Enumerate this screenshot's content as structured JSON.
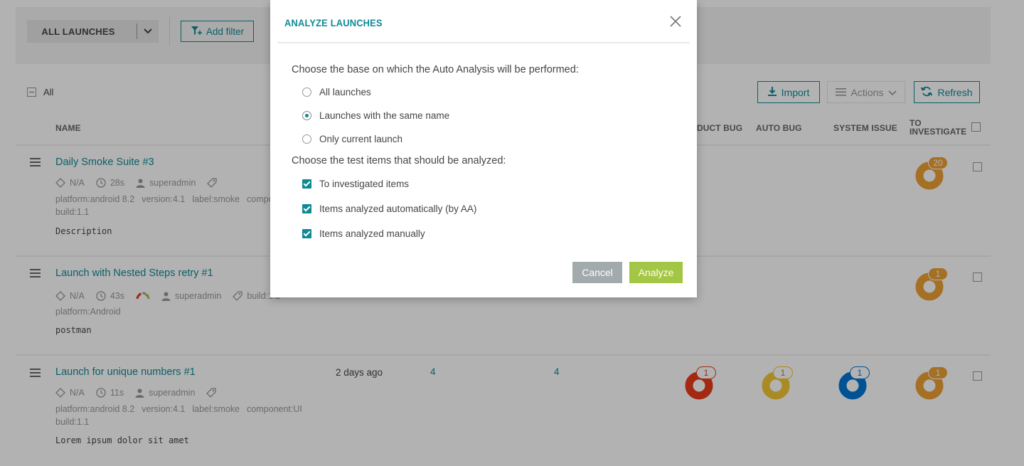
{
  "filter_bar": {
    "launch_selector": "ALL LAUNCHES",
    "add_filter": "Add filter"
  },
  "toolbar": {
    "select_all": "All",
    "import": "Import",
    "actions": "Actions",
    "refresh": "Refresh"
  },
  "columns": {
    "name": "NAME",
    "product_bug": "DUCT BUG",
    "auto_bug": "AUTO BUG",
    "system_issue": "SYSTEM ISSUE",
    "to_investigate_line1": "TO",
    "to_investigate_line2": "INVESTIGATE"
  },
  "launches": [
    {
      "name": "Daily Smoke Suite #3",
      "status": "N/A",
      "duration": "28s",
      "owner": "superadmin",
      "attributes": [
        "platform:android 8.2",
        "version:4.1",
        "label:smoke",
        "compon"
      ],
      "attributes_line2": "build:1.1",
      "description": "Description",
      "to_investigate": "20"
    },
    {
      "name": "Launch with Nested Steps retry #1",
      "status": "N/A",
      "duration": "43s",
      "owner": "superadmin",
      "tag_text": "build:1.2",
      "attributes": [
        "platform:Android"
      ],
      "description": "postman",
      "to_investigate": "1"
    },
    {
      "name": "Launch for unique numbers #1",
      "status": "N/A",
      "duration": "11s",
      "owner": "superadmin",
      "attributes": [
        "platform:android 8.2",
        "version:4.1",
        "label:smoke",
        "component:UI"
      ],
      "attributes_line2": "build:1.1",
      "description": "Lorem ipsum dolor sit amet",
      "start_time": "2 days ago",
      "total": "4",
      "passed": "4",
      "product_bug": "1",
      "auto_bug": "1",
      "system_issue": "1",
      "to_investigate": "1"
    }
  ],
  "modal": {
    "title": "ANALYZE LAUNCHES",
    "base_question": "Choose the base on which the Auto Analysis will be performed:",
    "base_options": [
      "All launches",
      "Launches with the same name",
      "Only current launch"
    ],
    "selected_base": "Launches with the same name",
    "items_question": "Choose the test items that should be analyzed:",
    "item_options": [
      "To investigated items",
      "Items analyzed automatically (by AA)",
      "Items analyzed manually"
    ],
    "cancel": "Cancel",
    "analyze": "Analyze"
  },
  "colors": {
    "accent": "#0f8a95",
    "analyze_green": "#a3c644",
    "to_investigate": "#eda034",
    "product_bug": "#ea3b1a",
    "auto_bug": "#f2c634",
    "system_issue": "#0276d6"
  }
}
